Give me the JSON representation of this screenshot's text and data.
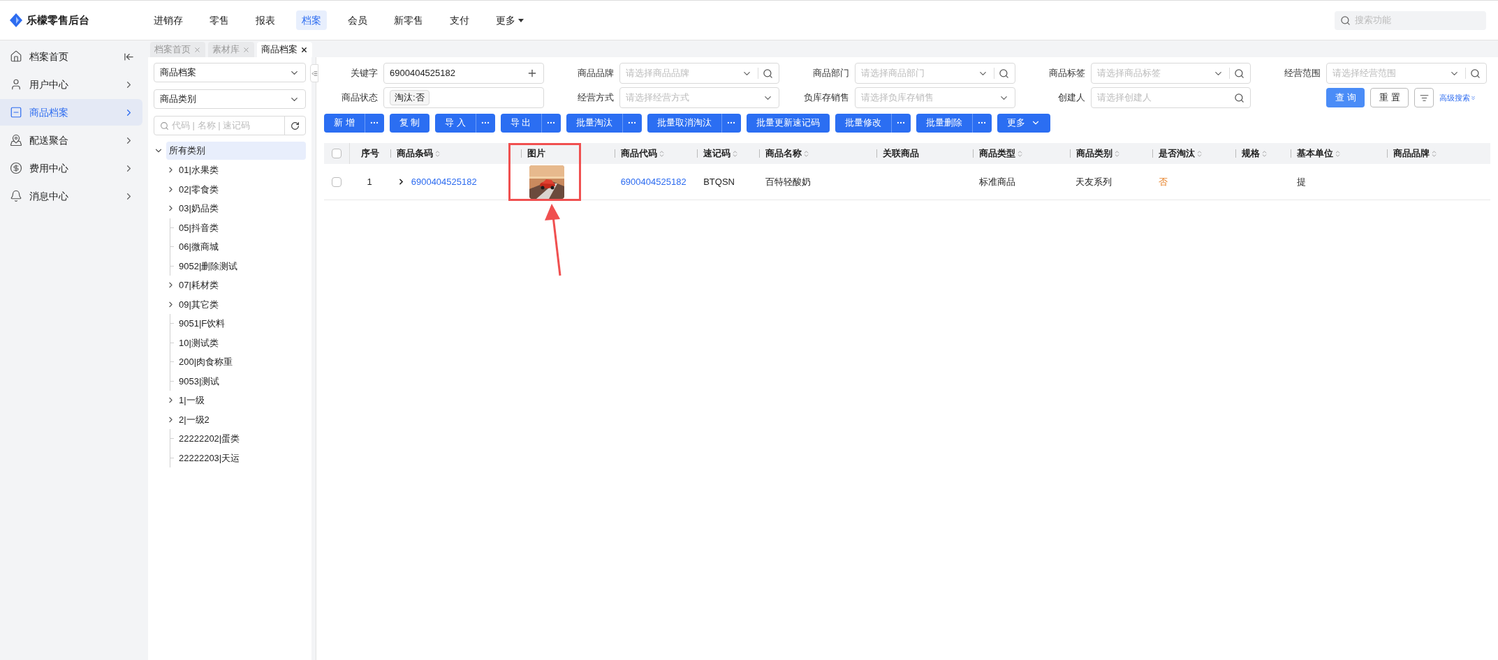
{
  "app": {
    "title": "乐檬零售后台"
  },
  "nav": [
    {
      "label": "进销存",
      "selected": false,
      "kind": "plain"
    },
    {
      "label": "零售",
      "selected": false,
      "kind": "plain"
    },
    {
      "label": "报表",
      "selected": false,
      "kind": "plain"
    },
    {
      "label": "档案",
      "selected": true,
      "kind": "plain"
    },
    {
      "label": "会员",
      "selected": false,
      "kind": "plain"
    },
    {
      "label": "新零售",
      "selected": false,
      "kind": "plain"
    },
    {
      "label": "支付",
      "selected": false,
      "kind": "plain"
    },
    {
      "label": "更多",
      "selected": false,
      "kind": "dropdown"
    }
  ],
  "top_search": {
    "placeholder": "搜索功能"
  },
  "sidebar": {
    "items": [
      {
        "label": "档案首页",
        "selected": false,
        "kind": "collapse"
      },
      {
        "label": "用户中心",
        "selected": false,
        "kind": "menu"
      },
      {
        "label": "商品档案",
        "selected": true,
        "kind": "menu"
      },
      {
        "label": "配送聚合",
        "selected": false,
        "kind": "menu"
      },
      {
        "label": "费用中心",
        "selected": false,
        "kind": "menu"
      },
      {
        "label": "消息中心",
        "selected": false,
        "kind": "menu"
      }
    ]
  },
  "tabs": [
    {
      "label": "档案首页",
      "selected": false
    },
    {
      "label": "素材库",
      "selected": false
    },
    {
      "label": "商品档案",
      "selected": true
    }
  ],
  "tree_panel": {
    "selects": [
      "商品档案",
      "商品类别"
    ],
    "search": {
      "placeholder": "代码 | 名称 | 速记码"
    },
    "root": {
      "label": "所有类别",
      "expanded": true,
      "selected": true,
      "children": [
        {
          "label": "01|水果类",
          "kind": "folder"
        },
        {
          "label": "02|零食类",
          "kind": "folder"
        },
        {
          "label": "03|奶品类",
          "kind": "folder"
        },
        {
          "label": "05|抖音类",
          "kind": "leaf"
        },
        {
          "label": "06|微商城",
          "kind": "leaf"
        },
        {
          "label": "9052|删除测试",
          "kind": "leaf"
        },
        {
          "label": "07|耗材类",
          "kind": "folder"
        },
        {
          "label": "09|其它类",
          "kind": "folder"
        },
        {
          "label": "9051|F饮料",
          "kind": "leaf"
        },
        {
          "label": "10|测试类",
          "kind": "leaf"
        },
        {
          "label": "200|肉食称重",
          "kind": "leaf"
        },
        {
          "label": "9053|测试",
          "kind": "leaf"
        },
        {
          "label": "1|一级",
          "kind": "folder"
        },
        {
          "label": "2|一级2",
          "kind": "folder"
        },
        {
          "label": "22222202|蛋类",
          "kind": "leaf"
        },
        {
          "label": "22222203|天运",
          "kind": "leaf"
        }
      ]
    }
  },
  "filters": [
    {
      "label": "关键字",
      "kind": "text",
      "value": "6900404525182"
    },
    {
      "label": "商品品牌",
      "kind": "select-search",
      "placeholder": "请选择商品品牌"
    },
    {
      "label": "商品部门",
      "kind": "select-search",
      "placeholder": "请选择商品部门"
    },
    {
      "label": "商品标签",
      "kind": "select-search",
      "placeholder": "请选择商品标签"
    },
    {
      "label": "经营范围",
      "kind": "select-search",
      "placeholder": "请选择经营范围"
    },
    {
      "label": "商品状态",
      "kind": "tags",
      "tags": [
        "淘汰:否"
      ]
    },
    {
      "label": "经营方式",
      "kind": "select",
      "placeholder": "请选择经营方式"
    },
    {
      "label": "负库存销售",
      "kind": "select",
      "placeholder": "请选择负库存销售"
    },
    {
      "label": "创建人",
      "kind": "search",
      "placeholder": "请选择创建人"
    }
  ],
  "filter_actions": {
    "query": "查 询",
    "reset": "重 置",
    "advanced": "高级搜索"
  },
  "toolbar": [
    {
      "label": "新 增",
      "kind": "split"
    },
    {
      "label": "复 制",
      "kind": "plain"
    },
    {
      "label": "导 入",
      "kind": "split"
    },
    {
      "label": "导 出",
      "kind": "split"
    },
    {
      "label": "批量淘汰",
      "kind": "split"
    },
    {
      "label": "批量取消淘汰",
      "kind": "split"
    },
    {
      "label": "批量更新速记码",
      "kind": "plain"
    },
    {
      "label": "批量修改",
      "kind": "split"
    },
    {
      "label": "批量删除",
      "kind": "split"
    },
    {
      "label": "更多",
      "kind": "dropdown"
    }
  ],
  "table": {
    "select_all_checked": false,
    "columns": [
      {
        "label": "序号",
        "sortable": false
      },
      {
        "label": "商品条码",
        "sortable": true
      },
      {
        "label": "图片",
        "sortable": false
      },
      {
        "label": "商品代码",
        "sortable": true
      },
      {
        "label": "速记码",
        "sortable": true
      },
      {
        "label": "商品名称",
        "sortable": true
      },
      {
        "label": "关联商品",
        "sortable": false
      },
      {
        "label": "商品类型",
        "sortable": true
      },
      {
        "label": "商品类别",
        "sortable": true
      },
      {
        "label": "是否淘汰",
        "sortable": true
      },
      {
        "label": "规格",
        "sortable": true
      },
      {
        "label": "基本单位",
        "sortable": true
      },
      {
        "label": "商品品牌",
        "sortable": true
      }
    ],
    "rows": [
      {
        "checked": false,
        "expanded": false,
        "cells": [
          {
            "kind": "text",
            "text": "1"
          },
          {
            "kind": "link",
            "text": "6900404525182"
          },
          {
            "kind": "picture"
          },
          {
            "kind": "link",
            "text": "6900404525182"
          },
          {
            "kind": "text",
            "text": "BTQSN"
          },
          {
            "kind": "text",
            "text": "百特轻酸奶"
          },
          {
            "kind": "empty"
          },
          {
            "kind": "text",
            "text": "标准商品"
          },
          {
            "kind": "text",
            "text": "天友系列"
          },
          {
            "kind": "warn",
            "text": "否"
          },
          {
            "kind": "empty"
          },
          {
            "kind": "text",
            "text": "提"
          },
          {
            "kind": "empty"
          }
        ]
      }
    ]
  }
}
